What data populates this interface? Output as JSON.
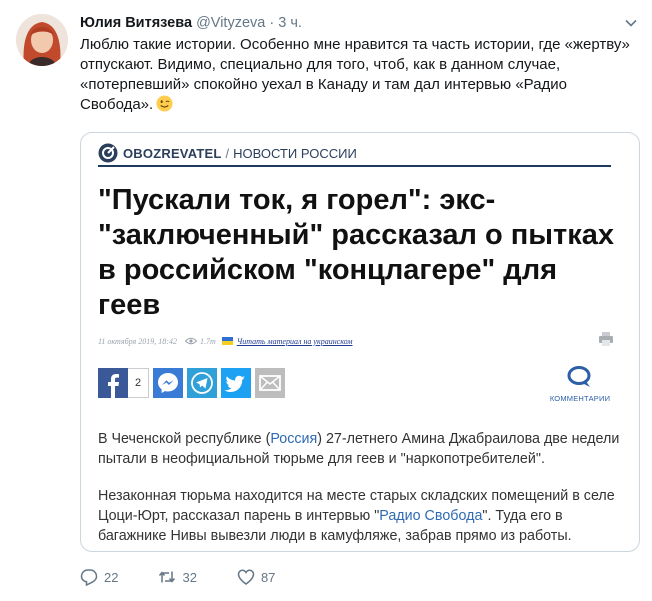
{
  "tweet": {
    "author_name": "Юлия Витязева",
    "author_handle": "@Vityzeva",
    "time_sep": "·",
    "time": "3 ч.",
    "text": "Люблю такие истории. Особенно мне нравится та часть истории, где «жертву» отпускают. Видимо, специально для того, чтоб, как в данном случае, «потерпевший» спокойно уехал в Канаду и там дал интервью «Радио Свобода».",
    "emoji": "winking-face-emoji"
  },
  "card": {
    "brand": "OBOZREVATEL",
    "brand_sep": "/",
    "section": "НОВОСТИ РОССИИ",
    "headline": "\"Пускали ток, я горел\": экс-\"заключенный\" рассказал о пытках в российском \"концлагере\" для геев",
    "date": "11 октября 2019, 18:42",
    "views": "1.7т",
    "read_link": "Читать материал на украинском",
    "fb_count": "2",
    "comments_label": "КОММЕНТАРИИ",
    "p1_before": "В Чеченской республике (",
    "p1_link": "Россия",
    "p1_after": ") 27-летнего Амина Джабраилова две недели пытали в неофициальной тюрьме для геев и \"наркопотребителей\".",
    "p2_before": "Незаконная тюрьма находится на месте старых складских помещений в селе Цоци-Юрт, рассказал парень в интервью \"",
    "p2_link": "Радио Свобода",
    "p2_after": "\". Туда его в багажнике Нивы вывезли люди в камуфляже, забрав прямо из работы."
  },
  "actions": {
    "replies": "22",
    "retweets": "32",
    "likes": "87"
  },
  "colors": {
    "text": "#14171a",
    "muted": "#657786",
    "brand": "#2b3f5c",
    "link": "#2f6ab2",
    "facebook": "#3b5998",
    "messenger": "#3a7bd5",
    "telegram": "#2fa0d8",
    "twitter": "#1da1f2",
    "email": "#bdbdbd"
  }
}
